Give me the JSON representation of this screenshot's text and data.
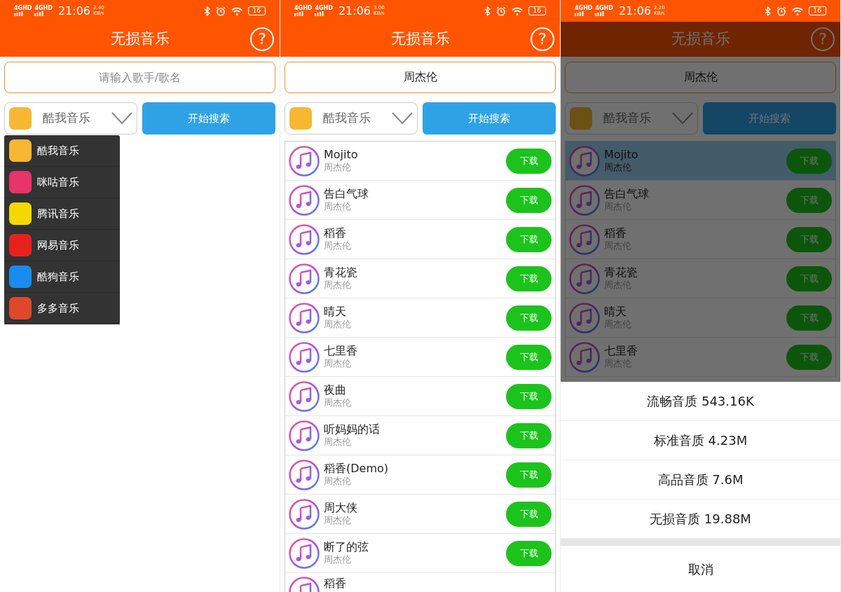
{
  "screens": [
    {
      "status_bar": {
        "signals": [
          "4GHD",
          "4GHD"
        ],
        "time": "21:06",
        "speed": "2.40",
        "speed_unit": "KB/s",
        "battery": "16"
      },
      "app_bar": {
        "title": "无损音乐",
        "help": "?"
      },
      "search": {
        "placeholder": "请输入歌手/歌名"
      },
      "source_select": {
        "label": "酷我音乐"
      },
      "search_button": "开始搜索",
      "source_menu": {
        "items": [
          {
            "label": "酷我音乐",
            "color": "#f7b733"
          },
          {
            "label": "咪咕音乐",
            "color": "#e8336b"
          },
          {
            "label": "腾讯音乐",
            "color": "#f5d800"
          },
          {
            "label": "网易音乐",
            "color": "#e8211c"
          },
          {
            "label": "酷狗音乐",
            "color": "#1a8cf0"
          },
          {
            "label": "多多音乐",
            "color": "#e0482b"
          }
        ]
      }
    },
    {
      "status_bar": {
        "signals": [
          "4GHD",
          "4GHD"
        ],
        "time": "21:06",
        "speed": "3.00",
        "speed_unit": "KB/s",
        "battery": "16"
      },
      "app_bar": {
        "title": "无损音乐",
        "help": "?"
      },
      "search": {
        "value": "周杰伦"
      },
      "source_select": {
        "label": "酷我音乐"
      },
      "search_button": "开始搜索",
      "songs": [
        {
          "title": "Mojito",
          "artist": "周杰伦",
          "button": "下载",
          "selected": false
        },
        {
          "title": "告白气球",
          "artist": "周杰伦",
          "button": "下载",
          "selected": false
        },
        {
          "title": "稻香",
          "artist": "周杰伦",
          "button": "下载",
          "selected": false
        },
        {
          "title": "青花瓷",
          "artist": "周杰伦",
          "button": "下载",
          "selected": false
        },
        {
          "title": "晴天",
          "artist": "周杰伦",
          "button": "下载",
          "selected": false
        },
        {
          "title": "七里香",
          "artist": "周杰伦",
          "button": "下载",
          "selected": false
        },
        {
          "title": "夜曲",
          "artist": "周杰伦",
          "button": "下载",
          "selected": false
        },
        {
          "title": "听妈妈的话",
          "artist": "周杰伦",
          "button": "下载",
          "selected": false
        },
        {
          "title": "稻香(Demo)",
          "artist": "周杰伦",
          "button": "下载",
          "selected": false
        },
        {
          "title": "周大侠",
          "artist": "周杰伦",
          "button": "下载",
          "selected": false
        },
        {
          "title": "断了的弦",
          "artist": "周杰伦",
          "button": "下载",
          "selected": false
        },
        {
          "title": "稻香",
          "selected": false
        }
      ]
    },
    {
      "status_bar": {
        "signals": [
          "4GHD",
          "4GHD"
        ],
        "time": "21:06",
        "speed": "2.20",
        "speed_unit": "KB/s",
        "battery": "16"
      },
      "app_bar": {
        "title": "无损音乐",
        "help": "?"
      },
      "search": {
        "value": "周杰伦"
      },
      "source_select": {
        "label": "酷我音乐"
      },
      "search_button": "开始搜索",
      "songs": [
        {
          "title": "Mojito",
          "artist": "周杰伦",
          "button": "下载",
          "selected": true
        },
        {
          "title": "告白气球",
          "artist": "周杰伦",
          "button": "下载",
          "selected": false
        },
        {
          "title": "稻香",
          "artist": "周杰伦",
          "button": "下载",
          "selected": false
        },
        {
          "title": "青花瓷",
          "artist": "周杰伦",
          "button": "下载",
          "selected": false
        },
        {
          "title": "晴天",
          "artist": "周杰伦",
          "button": "下载",
          "selected": false
        },
        {
          "title": "七里香",
          "artist": "周杰伦",
          "button": "下载",
          "selected": false
        }
      ],
      "quality_sheet": {
        "options": [
          "流畅音质 543.16K",
          "标准音质 4.23M",
          "高品音质 7.6M",
          "无损音质 19.88M"
        ],
        "cancel": "取消"
      }
    }
  ]
}
